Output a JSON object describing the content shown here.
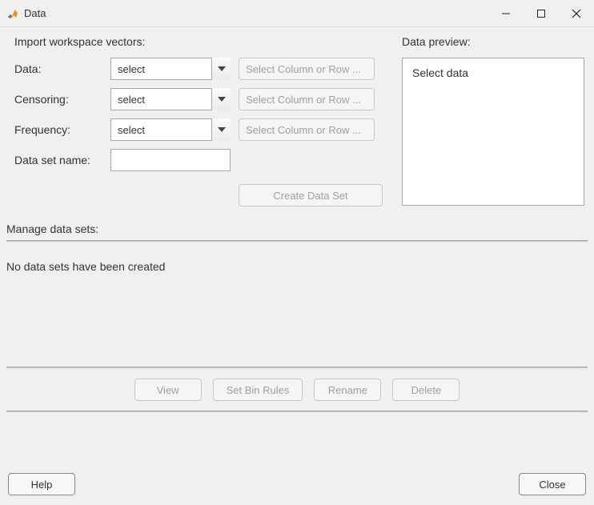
{
  "window": {
    "title": "Data"
  },
  "import": {
    "heading": "Import workspace vectors:",
    "rows": {
      "data": {
        "label": "Data:",
        "select_value": "select",
        "colrow_label": "Select Column or Row ..."
      },
      "censoring": {
        "label": "Censoring:",
        "select_value": "select",
        "colrow_label": "Select Column or Row ..."
      },
      "frequency": {
        "label": "Frequency:",
        "select_value": "select",
        "colrow_label": "Select Column or Row ..."
      },
      "dataset_name": {
        "label": "Data set name:",
        "value": ""
      }
    },
    "create_btn": "Create Data Set"
  },
  "preview": {
    "heading": "Data preview:",
    "content": "Select data"
  },
  "manage": {
    "heading": "Manage data sets:",
    "empty_text": "No data sets have been created",
    "buttons": {
      "view": "View",
      "set_bin_rules": "Set Bin Rules",
      "rename": "Rename",
      "delete": "Delete"
    }
  },
  "footer": {
    "help": "Help",
    "close": "Close"
  }
}
